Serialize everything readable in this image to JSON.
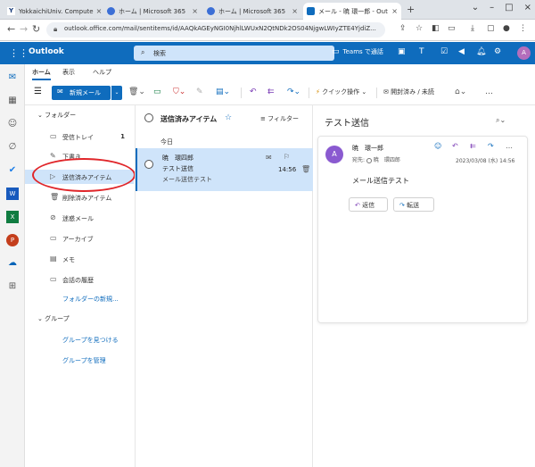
{
  "browser": {
    "tabs": [
      {
        "title": "YokkaichiUniv. Compute"
      },
      {
        "title": "ホーム | Microsoft 365"
      },
      {
        "title": "ホーム | Microsoft 365"
      },
      {
        "title": "メール - 暁 環一郎 - Out"
      }
    ],
    "url": "outlook.office.com/mail/sentitems/id/AAQkAGEyNGI0NjhlLWUxN2QtNDk2OS04NjgwLWIyZTE4YjdiZ..."
  },
  "header": {
    "brand": "Outlook",
    "search_placeholder": "検索",
    "teams_label": "Teams で通話",
    "avatar_initial": "A"
  },
  "ribbon": {
    "tabs": [
      "ホーム",
      "表示",
      "ヘルプ"
    ],
    "new_mail": "新規メール",
    "quick_steps": "クイック操作",
    "read_unread": "開封済み / 未読"
  },
  "folders": {
    "header": "フォルダー",
    "items": [
      {
        "label": "受信トレイ",
        "count": "1"
      },
      {
        "label": "下書き",
        "count": ""
      },
      {
        "label": "送信済みアイテム",
        "count": ""
      },
      {
        "label": "削除済みアイテム",
        "count": ""
      },
      {
        "label": "迷惑メール",
        "count": ""
      },
      {
        "label": "アーカイブ",
        "count": ""
      },
      {
        "label": "メモ",
        "count": ""
      },
      {
        "label": "会話の履歴",
        "count": ""
      }
    ],
    "new_folder": "フォルダーの新規...",
    "groups_header": "グループ",
    "find_groups": "グループを見つける",
    "manage_groups": "グループを管理"
  },
  "list": {
    "title": "送信済みアイテム",
    "filter": "フィルター",
    "date_group": "今日",
    "messages": [
      {
        "to": "暁　環四郎",
        "subject": "テスト送信",
        "preview": "メール送信テスト",
        "time": "14:56"
      }
    ]
  },
  "reading": {
    "subject": "テスト送信",
    "sender": "暁　環一郎",
    "to_label": "宛先:",
    "to_name": "暁　環四郎",
    "date": "2023/03/08 (水) 14:56",
    "body": "メール送信テスト",
    "reply": "返信",
    "forward": "転送"
  },
  "colors": {
    "brand": "#0f6cbd",
    "selection": "#cfe4fa",
    "annotation": "#e0262a"
  }
}
